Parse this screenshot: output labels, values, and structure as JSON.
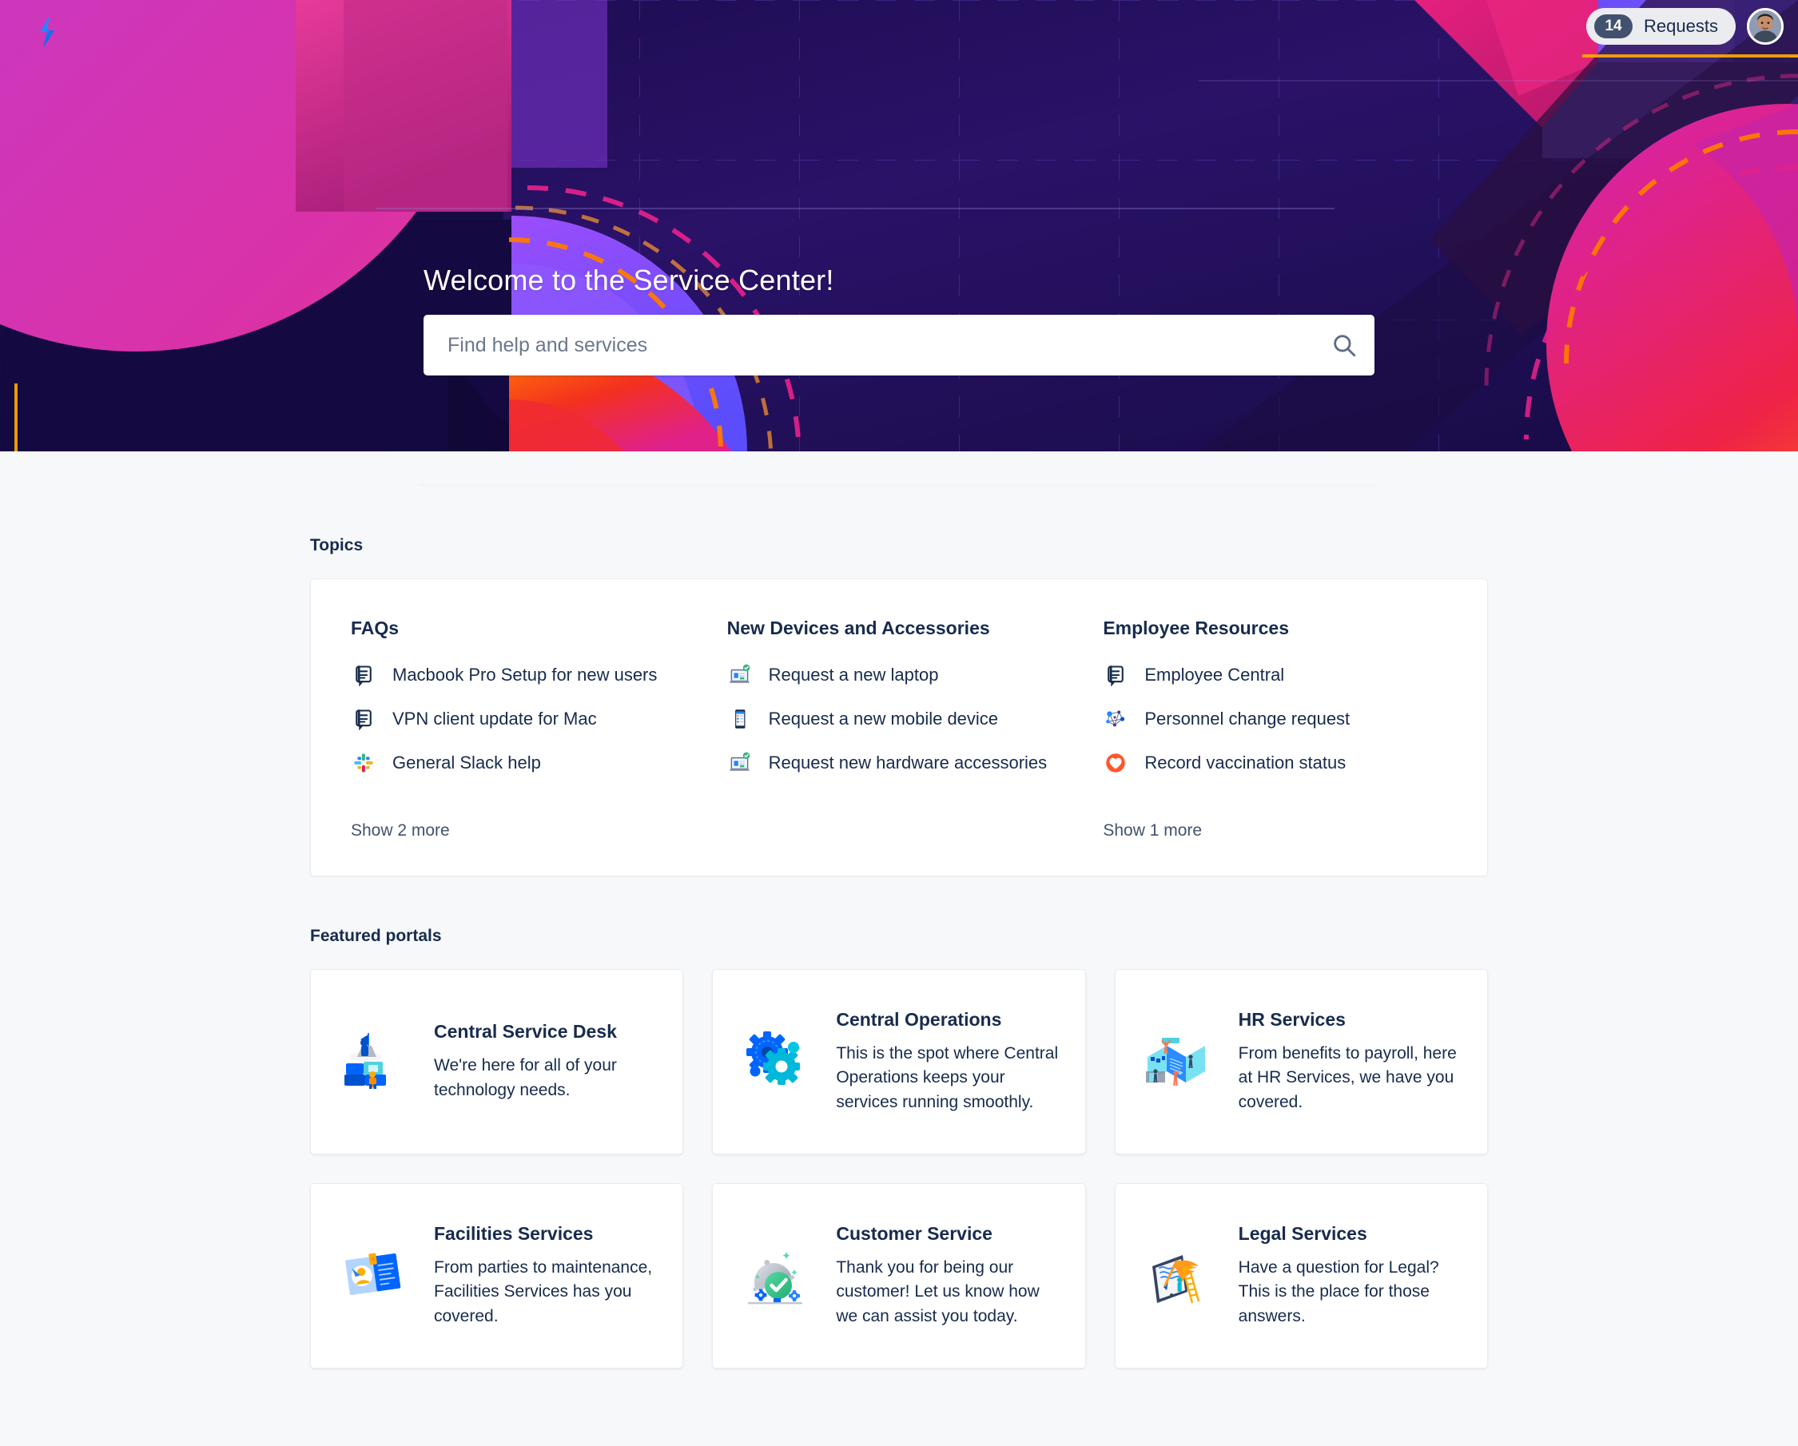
{
  "header": {
    "logo_icon": "jira-service-management-logo",
    "requests": {
      "count": "14",
      "label": "Requests"
    },
    "avatar": "user-avatar"
  },
  "hero": {
    "title": "Welcome to the Service Center!",
    "search": {
      "placeholder": "Find help and services",
      "value": "",
      "icon": "search-icon"
    },
    "colors": {
      "base": "#231259",
      "deep": "#170b45",
      "pink": "#d83bab",
      "magenta": "#e0218a",
      "purple": "#7d3cf8",
      "violet": "#5243d6",
      "orange": "#ff7a00",
      "red": "#f0263c"
    }
  },
  "topics": {
    "heading": "Topics",
    "columns": [
      {
        "title": "FAQs",
        "links": [
          {
            "label": "Macbook Pro Setup for new users",
            "icon": "knowledge-article-icon"
          },
          {
            "label": "VPN client update for Mac",
            "icon": "knowledge-article-icon"
          },
          {
            "label": "General Slack help",
            "icon": "slack-icon"
          }
        ],
        "show_more": "Show 2 more"
      },
      {
        "title": "New Devices and Accessories",
        "links": [
          {
            "label": "Request a new laptop",
            "icon": "laptop-icon"
          },
          {
            "label": "Request a new mobile device",
            "icon": "mobile-device-icon"
          },
          {
            "label": "Request new hardware accessories",
            "icon": "laptop-icon"
          }
        ],
        "show_more": ""
      },
      {
        "title": "Employee Resources",
        "links": [
          {
            "label": "Employee Central",
            "icon": "knowledge-article-icon"
          },
          {
            "label": "Personnel change request",
            "icon": "network-nodes-icon"
          },
          {
            "label": "Record vaccination status",
            "icon": "heart-shield-icon"
          }
        ],
        "show_more": "Show 1 more"
      }
    ]
  },
  "featured": {
    "heading": "Featured portals",
    "cards": [
      {
        "name": "Central Service Desk",
        "desc": "We're here for all of your technology needs.",
        "icon": "service-desk-blocks-icon"
      },
      {
        "name": "Central Operations",
        "desc": "This is the spot where Central Operations keeps your services running smoothly.",
        "icon": "gears-icon"
      },
      {
        "name": "HR Services",
        "desc": "From benefits to payroll, here at HR Services, we have you covered.",
        "icon": "hr-people-boards-icon"
      },
      {
        "name": "Facilities Services",
        "desc": "From parties to maintenance, Facilities Services has you covered.",
        "icon": "id-badge-icon"
      },
      {
        "name": "Customer Service",
        "desc": "Thank you for being our customer! Let us know how we can assist you today.",
        "icon": "service-cloche-check-icon"
      },
      {
        "name": "Legal Services",
        "desc": "Have a question for Legal? This is the place for those answers.",
        "icon": "quill-document-icon"
      }
    ]
  }
}
